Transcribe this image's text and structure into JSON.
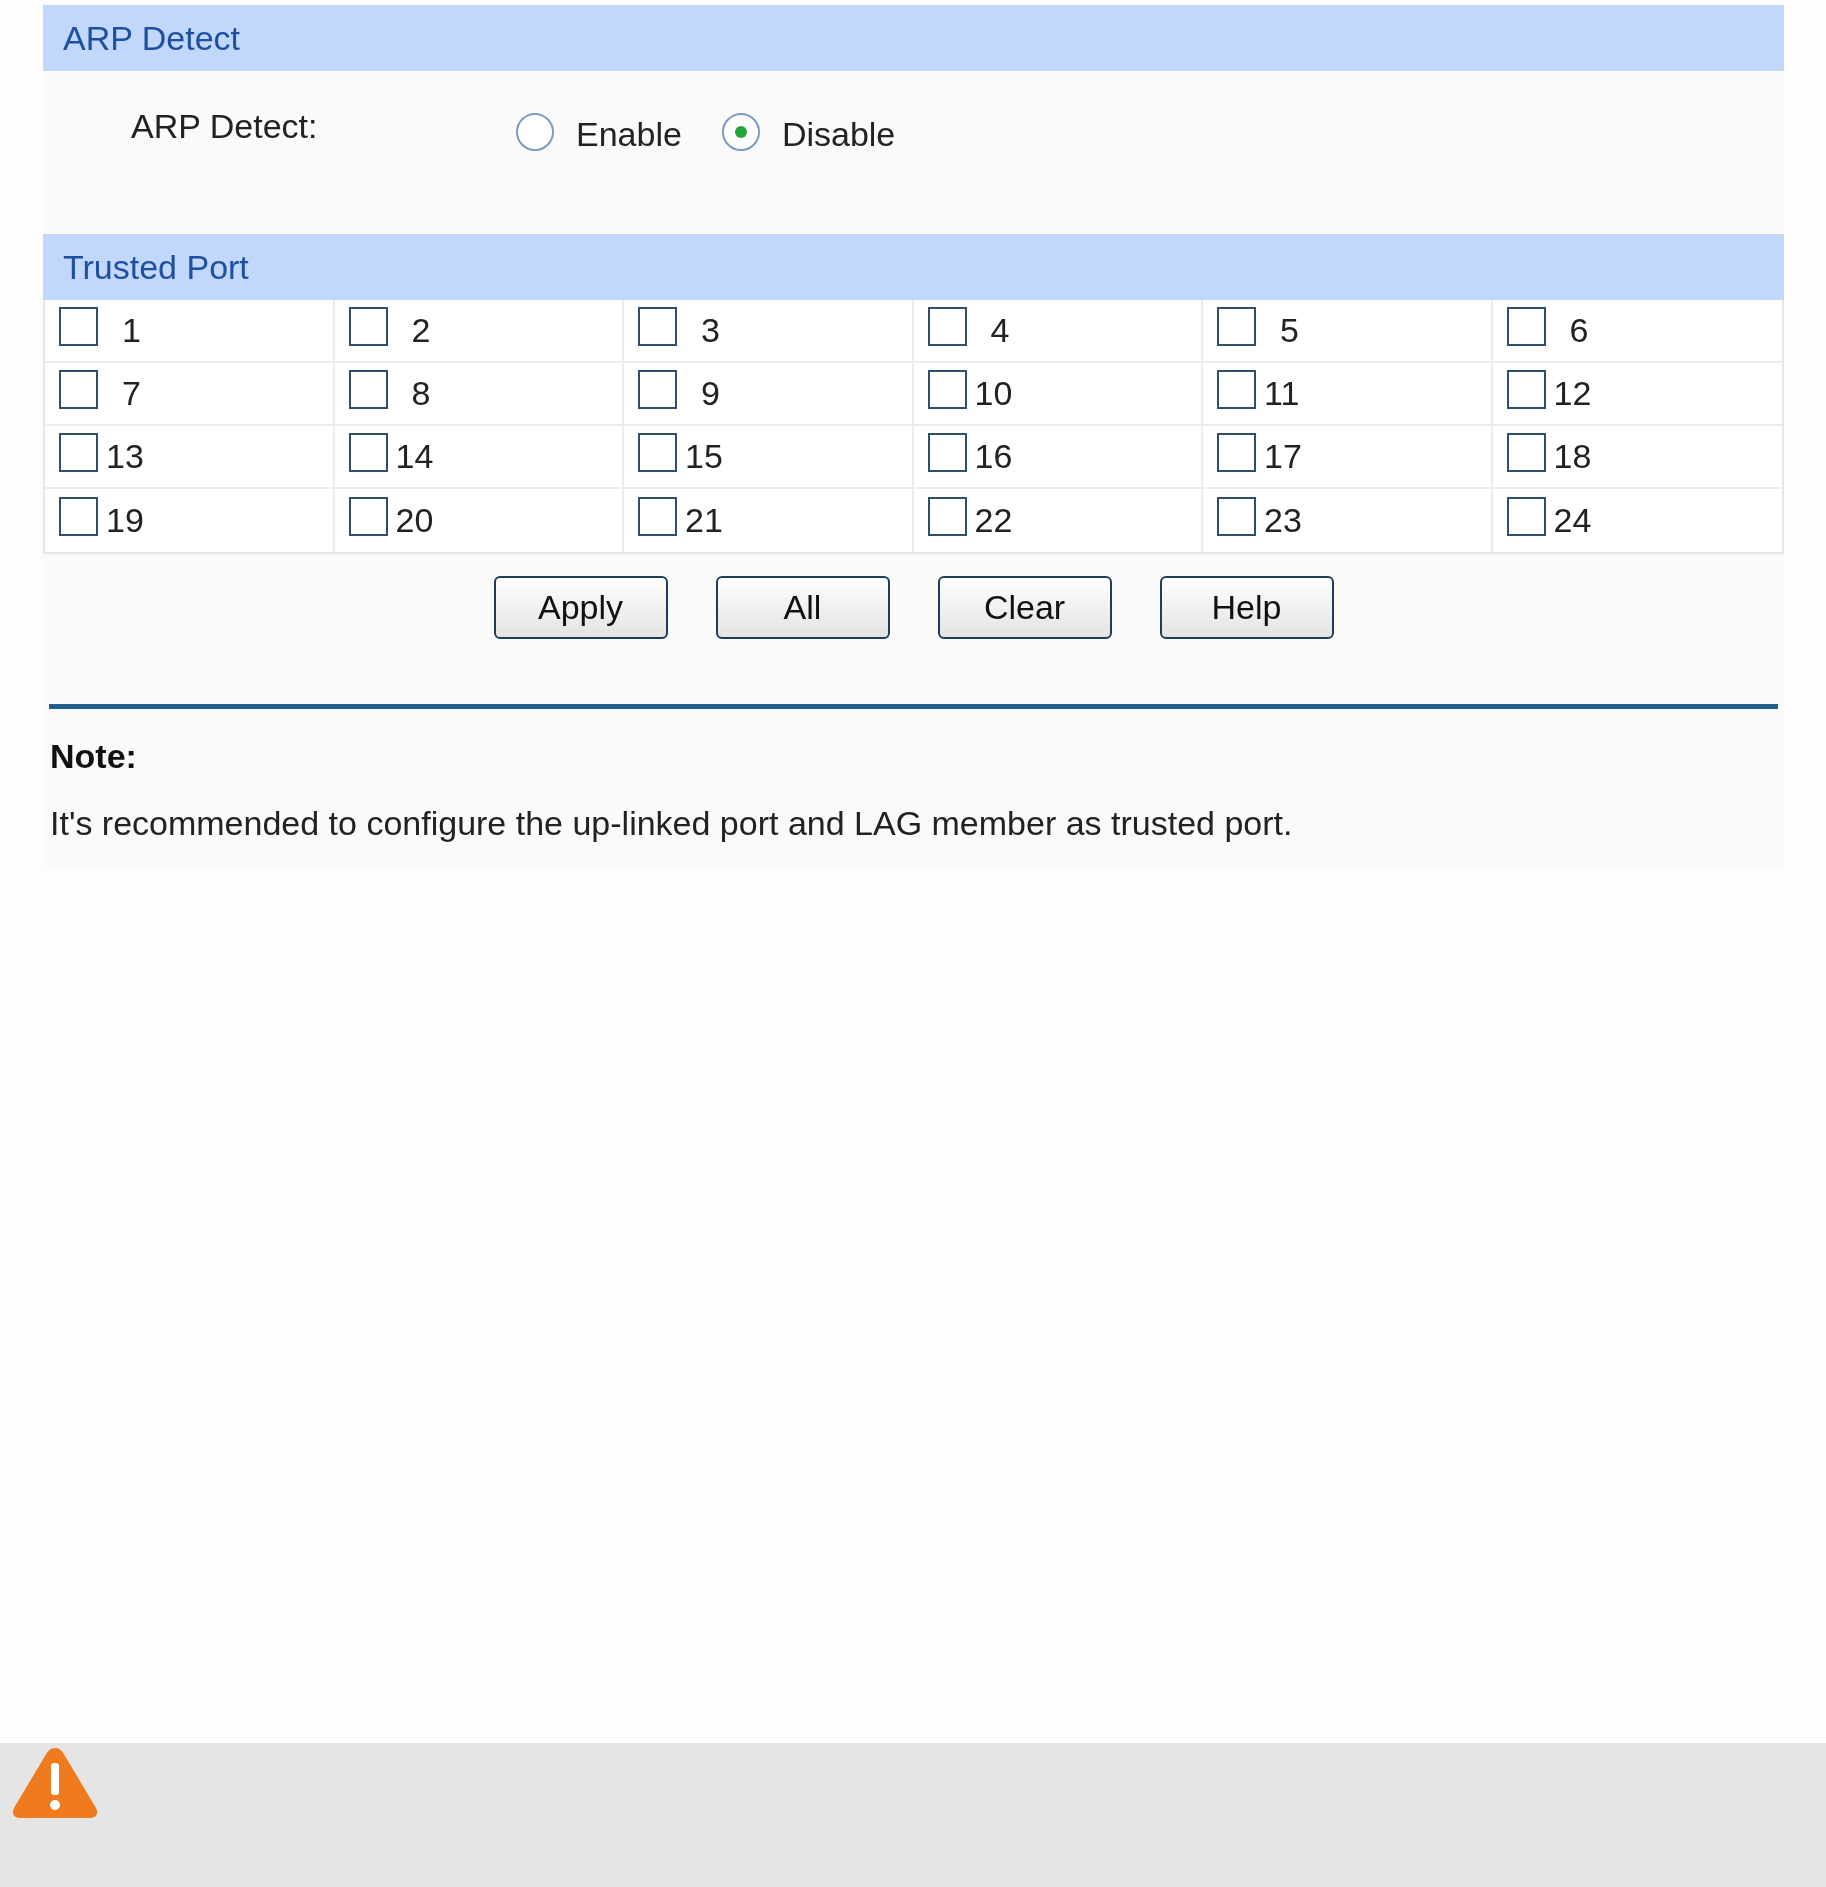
{
  "arp_section": {
    "title": "ARP Detect",
    "label": "ARP Detect:",
    "options": [
      {
        "label": "Enable",
        "selected": false
      },
      {
        "label": "Disable",
        "selected": true
      }
    ]
  },
  "trusted_section": {
    "title": "Trusted Port",
    "ports": [
      {
        "label": "1",
        "checked": false
      },
      {
        "label": "2",
        "checked": false
      },
      {
        "label": "3",
        "checked": false
      },
      {
        "label": "4",
        "checked": false
      },
      {
        "label": "5",
        "checked": false
      },
      {
        "label": "6",
        "checked": false
      },
      {
        "label": "7",
        "checked": false
      },
      {
        "label": "8",
        "checked": false
      },
      {
        "label": "9",
        "checked": false
      },
      {
        "label": "10",
        "checked": false
      },
      {
        "label": "11",
        "checked": false
      },
      {
        "label": "12",
        "checked": false
      },
      {
        "label": "13",
        "checked": false
      },
      {
        "label": "14",
        "checked": false
      },
      {
        "label": "15",
        "checked": false
      },
      {
        "label": "16",
        "checked": false
      },
      {
        "label": "17",
        "checked": false
      },
      {
        "label": "18",
        "checked": false
      },
      {
        "label": "19",
        "checked": false
      },
      {
        "label": "20",
        "checked": false
      },
      {
        "label": "21",
        "checked": false
      },
      {
        "label": "22",
        "checked": false
      },
      {
        "label": "23",
        "checked": false
      },
      {
        "label": "24",
        "checked": false
      }
    ]
  },
  "buttons": [
    "Apply",
    "All",
    "Clear",
    "Help"
  ],
  "note": {
    "title": "Note:",
    "text": "It's recommended to configure the up-linked port and LAG member as trusted port."
  }
}
